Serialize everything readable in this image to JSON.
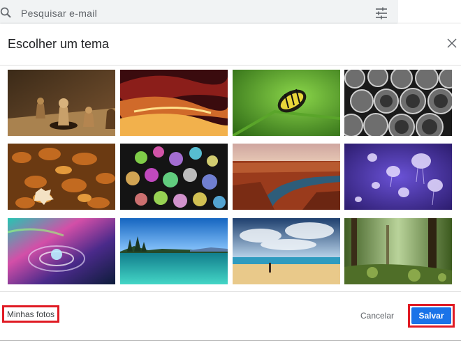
{
  "search": {
    "placeholder": "Pesquisar e-mail"
  },
  "dialog": {
    "title": "Escolher um tema",
    "themes": [
      {
        "name": "chess"
      },
      {
        "name": "canyon-rock"
      },
      {
        "name": "caterpillar"
      },
      {
        "name": "pipes"
      },
      {
        "name": "autumn-leaves"
      },
      {
        "name": "bokeh-lights"
      },
      {
        "name": "river-canyon"
      },
      {
        "name": "jellyfish"
      },
      {
        "name": "water-drop"
      },
      {
        "name": "lake-island"
      },
      {
        "name": "beach"
      },
      {
        "name": "forest"
      }
    ],
    "my_photos_label": "Minhas fotos",
    "cancel_label": "Cancelar",
    "save_label": "Salvar"
  },
  "colors": {
    "primary_button": "#1a73e8",
    "highlight_outline": "#e01b24"
  }
}
